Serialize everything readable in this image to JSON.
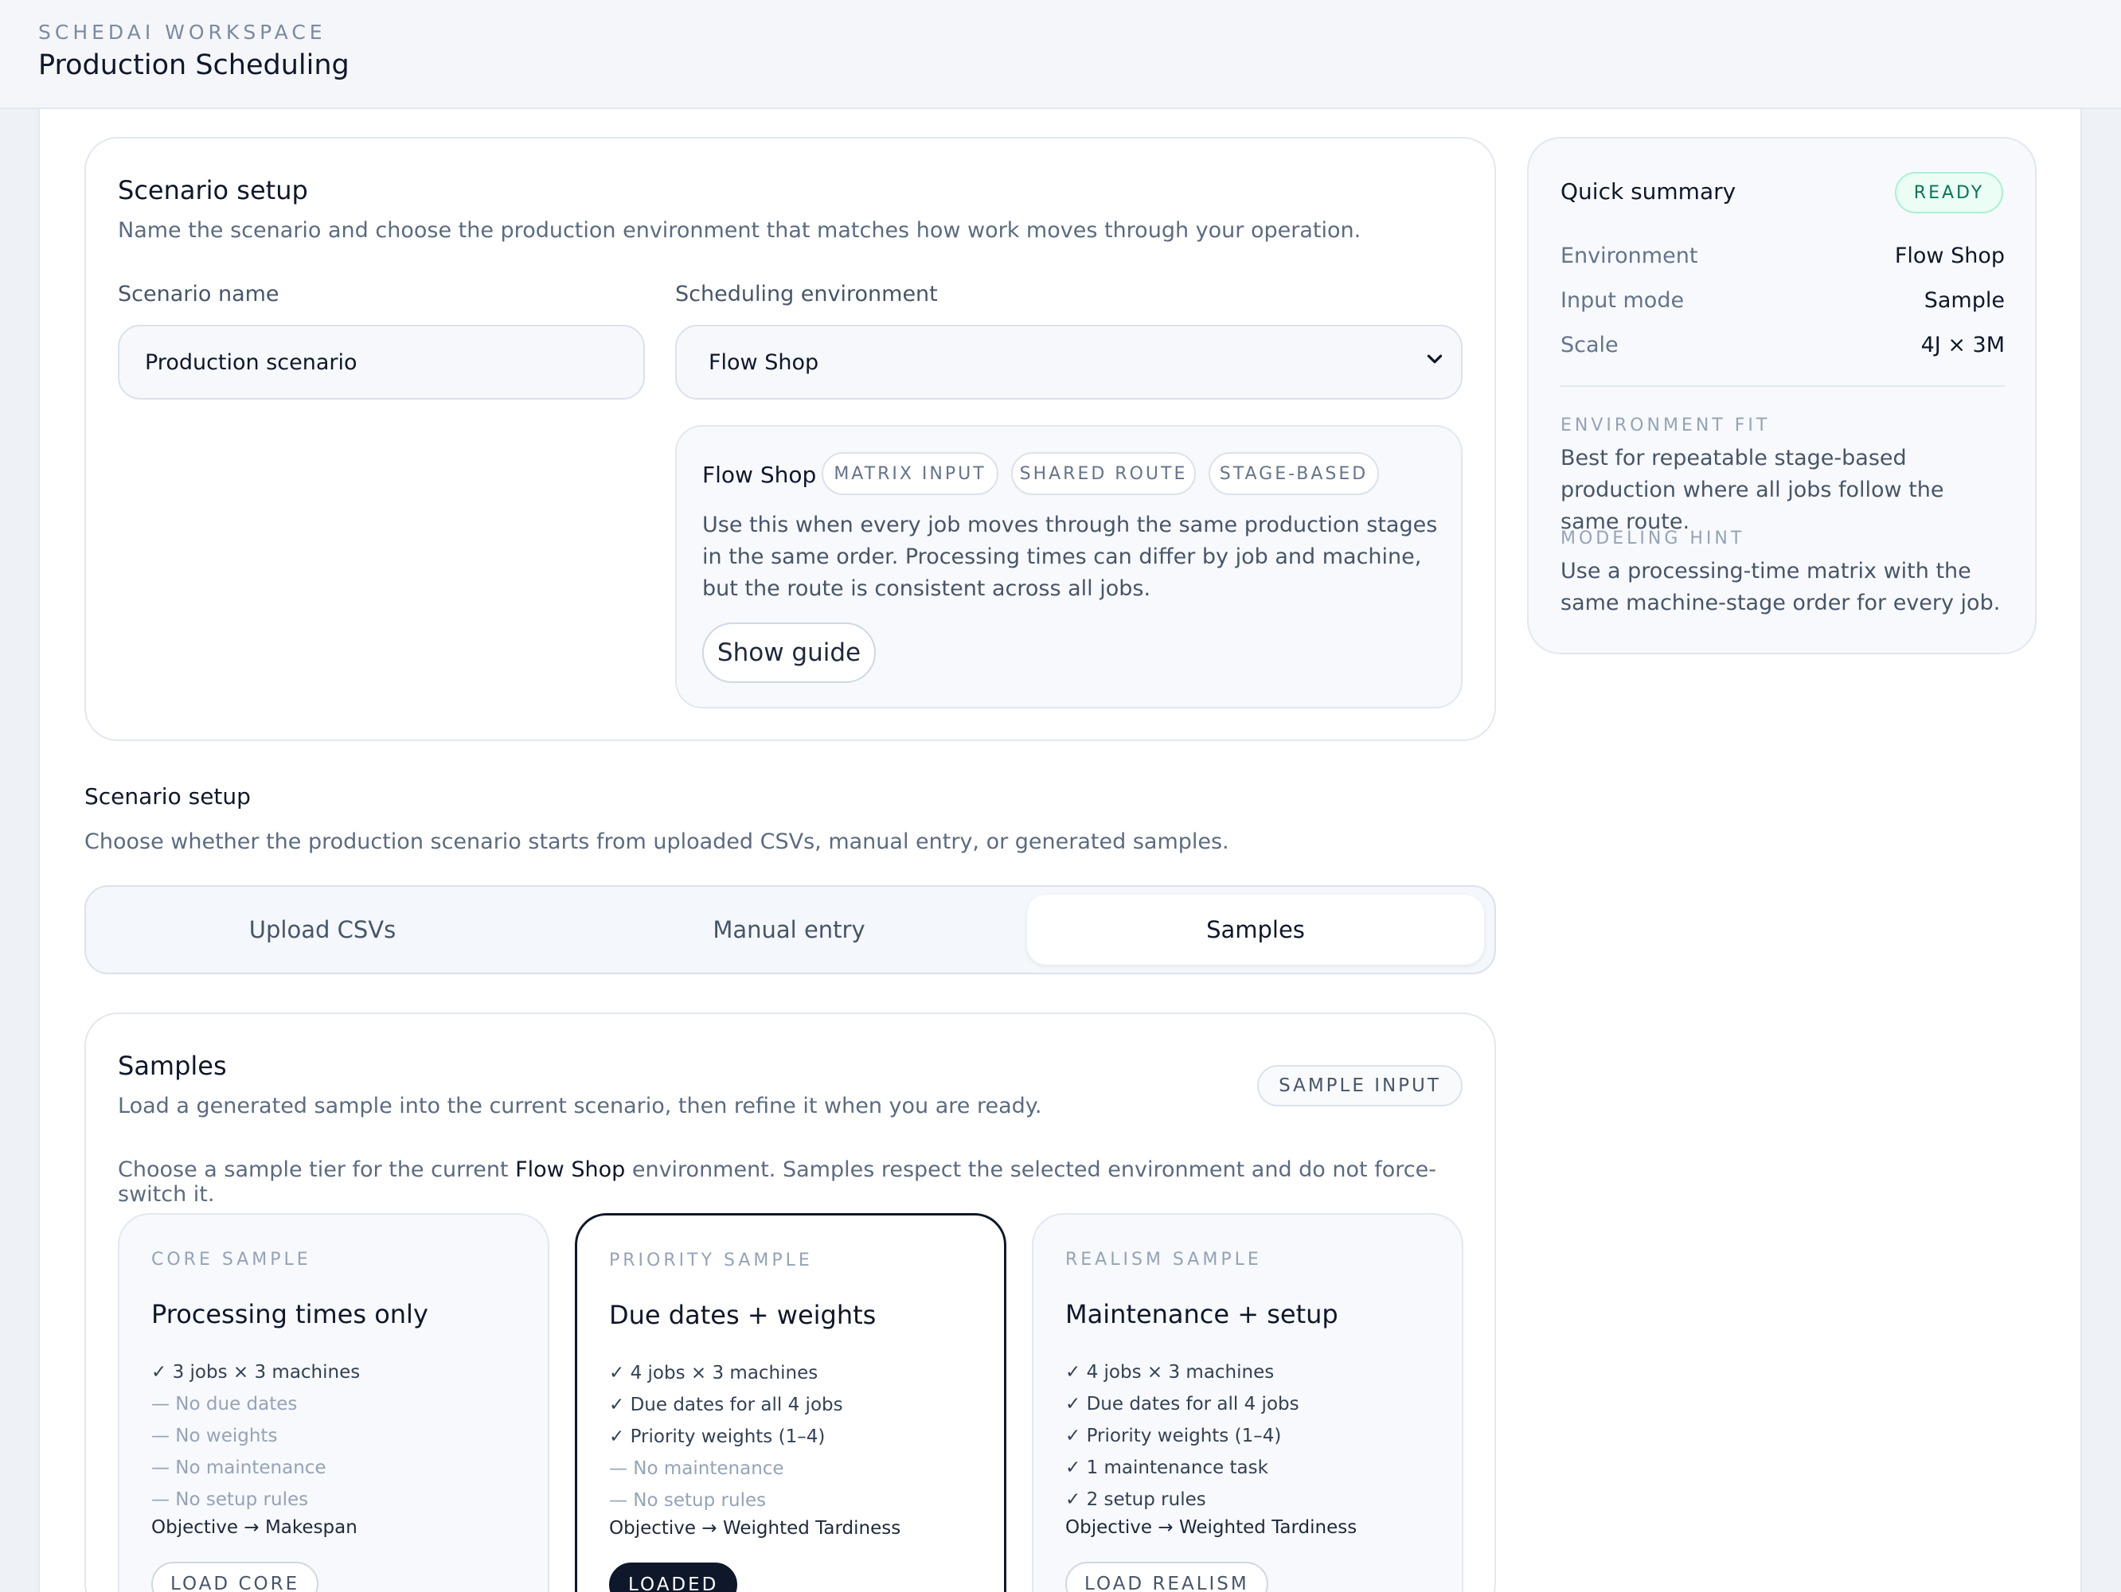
{
  "header": {
    "workspace": "SCHEDAI WORKSPACE",
    "title": "Production Scheduling"
  },
  "setup": {
    "title": "Scenario setup",
    "description": "Name the scenario and choose the production environment that matches how work moves through your operation.",
    "name_label": "Scenario name",
    "name_value": "Production scenario",
    "env_label": "Scheduling environment",
    "env_value": "Flow Shop",
    "env_card": {
      "name": "Flow Shop",
      "tags": [
        "MATRIX INPUT",
        "SHARED ROUTE",
        "STAGE-BASED"
      ],
      "description": "Use this when every job moves through the same production stages in the same order. Processing times can differ by job and machine, but the route is consistent across all jobs.",
      "guide_button": "Show guide"
    }
  },
  "summary": {
    "title": "Quick summary",
    "status": "READY",
    "rows": [
      {
        "key": "Environment",
        "value": "Flow Shop"
      },
      {
        "key": "Input mode",
        "value": "Sample"
      },
      {
        "key": "Scale",
        "value": "4J × 3M"
      }
    ],
    "fit_label": "ENVIRONMENT FIT",
    "fit_text": "Best for repeatable stage-based production where all jobs follow the same route.",
    "hint_label": "MODELING HINT",
    "hint_text": "Use a processing-time matrix with the same machine-stage order for every job."
  },
  "input_mode": {
    "title": "Scenario setup",
    "description": "Choose whether the production scenario starts from uploaded CSVs, manual entry, or generated samples.",
    "tabs": [
      "Upload CSVs",
      "Manual entry",
      "Samples"
    ],
    "active_tab": "Samples"
  },
  "samples": {
    "title": "Samples",
    "description": "Load a generated sample into the current scenario, then refine it when you are ready.",
    "badge": "SAMPLE INPUT",
    "intro_before": "Choose a sample tier for the current",
    "intro_env": "Flow Shop",
    "intro_after": "environment. Samples respect the selected environment and do not force-switch it.",
    "tiers": [
      {
        "eyebrow": "CORE SAMPLE",
        "title": "Processing times only",
        "features": [
          {
            "text": "✓ 3 jobs × 3 machines",
            "on": true
          },
          {
            "text": "— No due dates",
            "on": false
          },
          {
            "text": "— No weights",
            "on": false
          },
          {
            "text": "— No maintenance",
            "on": false
          },
          {
            "text": "— No setup rules",
            "on": false
          }
        ],
        "objective": "Objective → Makespan",
        "button": "LOAD CORE"
      },
      {
        "eyebrow": "PRIORITY SAMPLE",
        "title": "Due dates + weights",
        "features": [
          {
            "text": "✓ 4 jobs × 3 machines",
            "on": true
          },
          {
            "text": "✓ Due dates for all 4 jobs",
            "on": true
          },
          {
            "text": "✓ Priority weights (1–4)",
            "on": true
          },
          {
            "text": "— No maintenance",
            "on": false
          },
          {
            "text": "— No setup rules",
            "on": false
          }
        ],
        "objective": "Objective → Weighted Tardiness",
        "button": "LOADED"
      },
      {
        "eyebrow": "REALISM SAMPLE",
        "title": "Maintenance + setup",
        "features": [
          {
            "text": "✓ 4 jobs × 3 machines",
            "on": true
          },
          {
            "text": "✓ Due dates for all 4 jobs",
            "on": true
          },
          {
            "text": "✓ Priority weights (1–4)",
            "on": true
          },
          {
            "text": "✓ 1 maintenance task",
            "on": true
          },
          {
            "text": "✓ 2 setup rules",
            "on": true
          }
        ],
        "objective": "Objective → Weighted Tardiness",
        "button": "LOAD REALISM"
      }
    ]
  }
}
